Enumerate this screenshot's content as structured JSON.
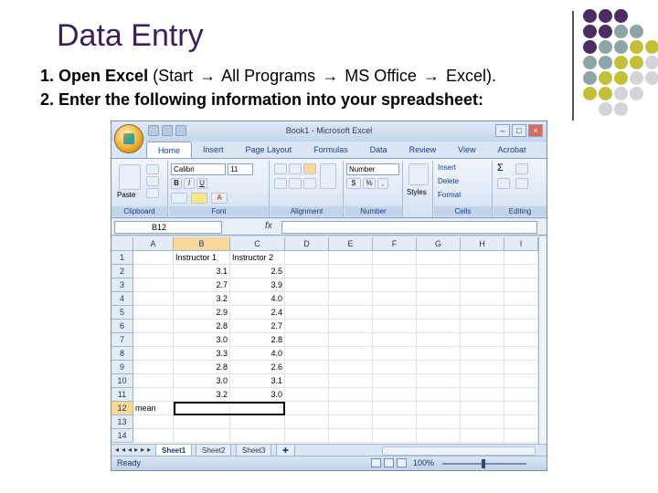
{
  "slide": {
    "title": "Data Entry",
    "step1_num": "1.",
    "step1_a": "Open Excel",
    "step1_b": "(Start",
    "step1_c": "All Programs",
    "step1_d": "MS Office",
    "step1_e": "Excel).",
    "step2": "2. Enter the following information into your spreadsheet:",
    "arrow": "→"
  },
  "colors": {
    "title": "#3b1f57",
    "dot_purple": "#4a2d63",
    "dot_teal": "#8ea5a8",
    "dot_olive": "#c2bf38",
    "dot_lavender": "#d3d3dc"
  },
  "excel": {
    "window_title": "Book1 - Microsoft Excel",
    "tabs": [
      "Home",
      "Insert",
      "Page Layout",
      "Formulas",
      "Data",
      "Review",
      "View",
      "Acrobat"
    ],
    "font_name": "Calibri",
    "font_size": "11",
    "number_format": "Number",
    "groups": {
      "clipboard": "Clipboard",
      "font": "Font",
      "alignment": "Alignment",
      "number": "Number",
      "styles": "Styles",
      "cells": "Cells",
      "editing": "Editing"
    },
    "buttons": {
      "paste": "Paste",
      "bold": "B",
      "italic": "I",
      "underline": "U",
      "dollar": "$",
      "percent": "%",
      "comma": ",",
      "styles": "Styles",
      "insert": "Insert",
      "delete": "Delete",
      "format": "Format",
      "sum": "Σ"
    },
    "name_box": "B12",
    "fx": "fx",
    "columns": [
      "A",
      "B",
      "C",
      "D",
      "E",
      "F",
      "G",
      "H",
      "I"
    ],
    "rows": [
      {
        "num": "1",
        "a": "",
        "b": "Instructor 1",
        "c": "Instructor 2"
      },
      {
        "num": "2",
        "a": "",
        "b": "3.1",
        "c": "2.5"
      },
      {
        "num": "3",
        "a": "",
        "b": "2.7",
        "c": "3.9"
      },
      {
        "num": "4",
        "a": "",
        "b": "3.2",
        "c": "4.0"
      },
      {
        "num": "5",
        "a": "",
        "b": "2.9",
        "c": "2.4"
      },
      {
        "num": "6",
        "a": "",
        "b": "2.8",
        "c": "2.7"
      },
      {
        "num": "7",
        "a": "",
        "b": "3.0",
        "c": "2.8"
      },
      {
        "num": "8",
        "a": "",
        "b": "3.3",
        "c": "4.0"
      },
      {
        "num": "9",
        "a": "",
        "b": "2.8",
        "c": "2.6"
      },
      {
        "num": "10",
        "a": "",
        "b": "3.0",
        "c": "3.1"
      },
      {
        "num": "11",
        "a": "",
        "b": "3.2",
        "c": "3.0"
      },
      {
        "num": "12",
        "a": "mean",
        "b": "",
        "c": ""
      },
      {
        "num": "13",
        "a": "",
        "b": "",
        "c": ""
      },
      {
        "num": "14",
        "a": "",
        "b": "",
        "c": ""
      }
    ],
    "sheets": [
      "Sheet1",
      "Sheet2",
      "Sheet3"
    ],
    "status": "Ready",
    "zoom": "100%"
  }
}
